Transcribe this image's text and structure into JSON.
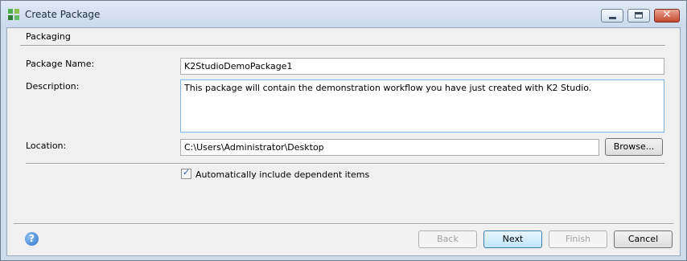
{
  "window": {
    "title": "Create Package",
    "icon": "k2-package-icon"
  },
  "title_buttons": {
    "minimize_icon": "minimize-icon",
    "maximize_icon": "maximize-icon",
    "close_label": "✕"
  },
  "section": {
    "title": "Packaging"
  },
  "form": {
    "package_name_label": "Package Name:",
    "package_name_value": "K2StudioDemoPackage1",
    "description_label": "Description:",
    "description_value": "This package will contain the demonstration workflow you have just created with K2 Studio.",
    "location_label": "Location:",
    "location_value": "C:\\Users\\Administrator\\Desktop",
    "browse_label": "Browse...",
    "auto_include_label": "Automatically include dependent items",
    "auto_include_checked": "✓"
  },
  "footer": {
    "help_label": "?",
    "back_label": "Back",
    "next_label": "Next",
    "finish_label": "Finish",
    "cancel_label": "Cancel"
  }
}
